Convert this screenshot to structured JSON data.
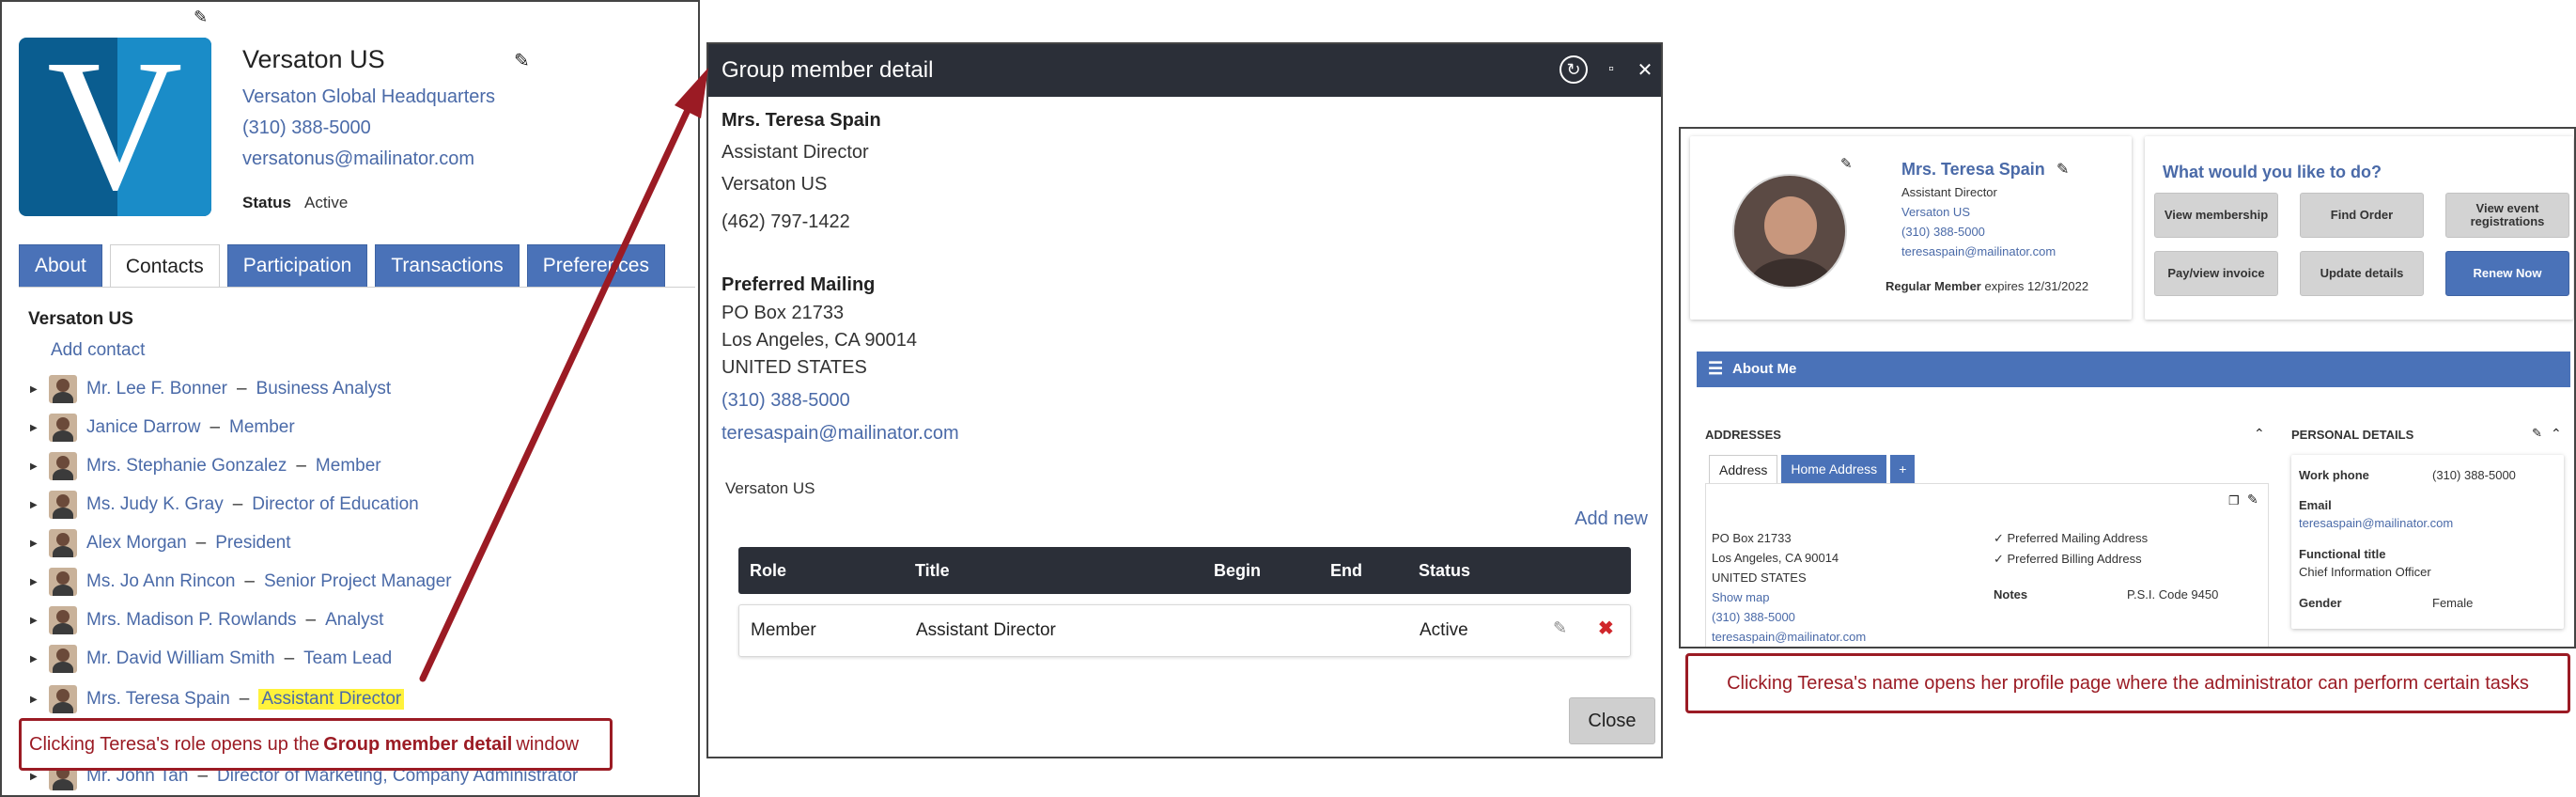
{
  "panel1": {
    "org": {
      "name": "Versaton US",
      "hq": "Versaton Global Headquarters",
      "phone": "(310) 388-5000",
      "email": "versatonus@mailinator.com",
      "status_label": "Status",
      "status_value": "Active",
      "logo_letter": "V"
    },
    "tabs": [
      "About",
      "Contacts",
      "Participation",
      "Transactions",
      "Preferences"
    ],
    "contacts_title": "Versaton US",
    "add_contact": "Add contact",
    "contacts": [
      {
        "name": "Mr. Lee F. Bonner",
        "role": "Business Analyst"
      },
      {
        "name": "Janice Darrow",
        "role": "Member"
      },
      {
        "name": "Mrs. Stephanie Gonzalez",
        "role": "Member"
      },
      {
        "name": "Ms. Judy K. Gray",
        "role": "Director of Education"
      },
      {
        "name": "Alex Morgan",
        "role": "President"
      },
      {
        "name": "Ms. Jo Ann Rincon",
        "role": "Senior Project Manager"
      },
      {
        "name": "Mrs. Madison P. Rowlands",
        "role": "Analyst"
      },
      {
        "name": "Mr. David William Smith",
        "role": "Team Lead"
      },
      {
        "name": "Mrs. Teresa Spain",
        "role": "Assistant Director"
      },
      {
        "name": "Mr. John Tan",
        "role": "Director of Marketing, Company Administrator"
      }
    ],
    "separator": "–",
    "callout_pre": "Clicking Teresa's role opens up the ",
    "callout_bold": "Group member detail",
    "callout_post": " window"
  },
  "panel2": {
    "title": "Group member detail",
    "name": "Mrs. Teresa Spain",
    "job_title": "Assistant Director",
    "org": "Versaton US",
    "phone_line": "(462) 797-1422",
    "mailing_label": "Preferred Mailing",
    "address": [
      "PO Box 21733",
      "Los Angeles, CA 90014",
      "UNITED STATES"
    ],
    "phone_link": "(310) 388-5000",
    "email_link": "teresaspain@mailinator.com",
    "group_name": "Versaton US",
    "add_new": "Add new",
    "table": {
      "headers": [
        "Role",
        "Title",
        "Begin",
        "End",
        "Status"
      ],
      "row": {
        "role": "Member",
        "title": "Assistant Director",
        "begin": "",
        "end": "",
        "status": "Active"
      }
    },
    "close": "Close"
  },
  "panel3": {
    "name": "Mrs. Teresa Spain",
    "job_title": "Assistant Director",
    "org": "Versaton US",
    "phone": "(310) 388-5000",
    "email": "teresaspain@mailinator.com",
    "membership_label": "Regular Member",
    "membership_expiry": "expires 12/31/2022",
    "todo_title": "What would you like to do?",
    "actions": [
      "View membership",
      "Find Order",
      "View event registrations",
      "Pay/view invoice",
      "Update details",
      "Renew Now"
    ],
    "about_me": "About Me",
    "addresses_label": "ADDRESSES",
    "addr_tabs": [
      "Address",
      "Home Address",
      "+"
    ],
    "address": [
      "PO Box 21733",
      "Los Angeles, CA 90014",
      "UNITED STATES"
    ],
    "show_map": "Show map",
    "addr_phone": "(310) 388-5000",
    "addr_email": "teresaspain@mailinator.com",
    "pref_mailing": "✓ Preferred Mailing Address",
    "pref_billing": "✓ Preferred Billing Address",
    "notes_label": "Notes",
    "notes_value": "P.S.I. Code 9450",
    "personal_label": "PERSONAL DETAILS",
    "work_phone_label": "Work phone",
    "work_phone_value": "(310) 388-5000",
    "email_label": "Email",
    "email_value": "teresaspain@mailinator.com",
    "functional_label": "Functional title",
    "functional_value": "Chief Information Officer",
    "gender_label": "Gender",
    "gender_value": "Female",
    "callout": "Clicking Teresa's name opens her profile page where the administrator can perform certain tasks"
  },
  "colors": {
    "accent": "#4a72b8",
    "link": "#4a6aa8",
    "callout": "#9b1b24",
    "dark_header": "#2b2f38",
    "highlight": "#fff23b"
  }
}
